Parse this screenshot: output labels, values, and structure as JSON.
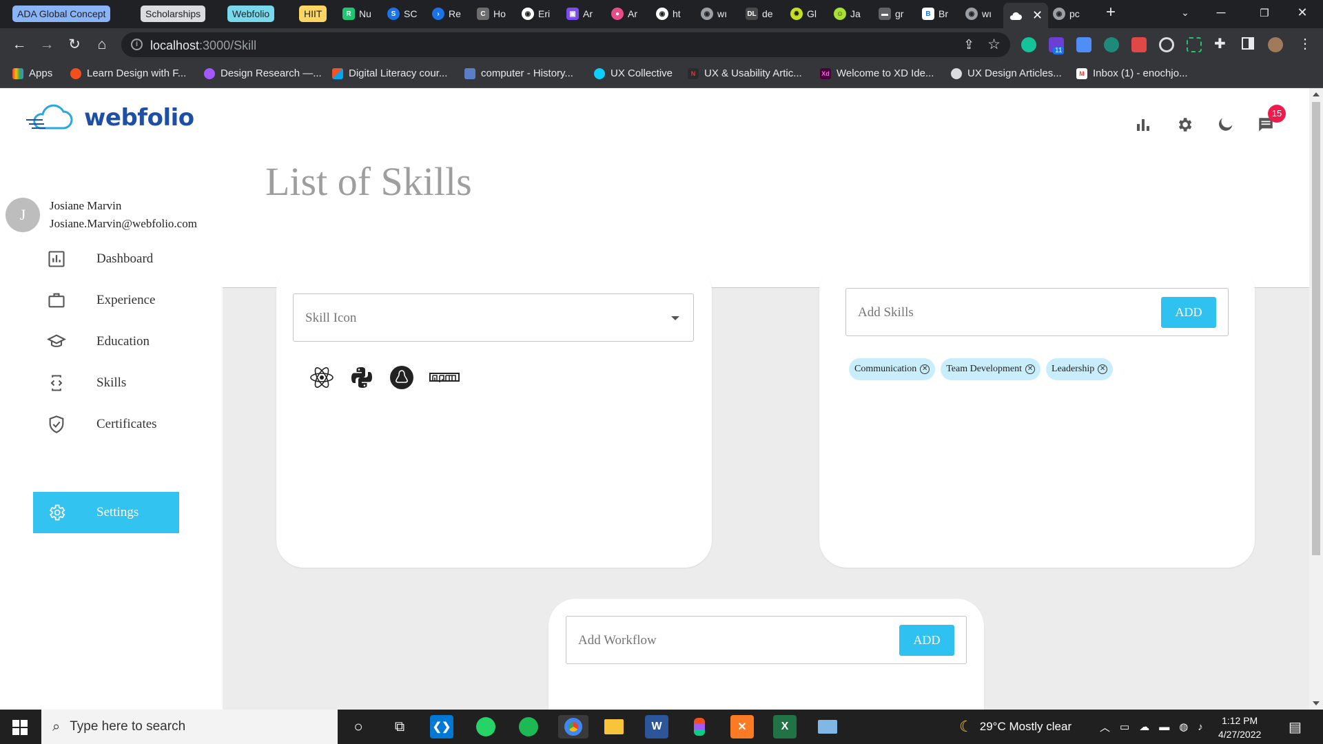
{
  "browser": {
    "tab_groups": [
      "ADA Global Concept",
      "Scholarships",
      "Webfolio",
      "HIIT"
    ],
    "mini_tabs": [
      "Nu",
      "SC",
      "Re",
      "Ho",
      "Eri",
      "Ar",
      "Ar",
      "ht",
      "wı",
      "de",
      "Gl",
      "Ja",
      "gr",
      "Br",
      "wı",
      "pc"
    ],
    "url_host": "localhost",
    "url_path": ":3000/Skill",
    "bookmarks": [
      "Apps",
      "Learn Design with F...",
      "Design Research —...",
      "Digital Literacy cour...",
      "computer - History...",
      "UX Collective",
      "UX & Usability Artic...",
      "Welcome to XD Ide...",
      "UX Design Articles...",
      "Inbox (1) - enochjo..."
    ],
    "extension_badge": "11"
  },
  "app": {
    "logo_text": "webfolio",
    "notification_count": "15",
    "page_title": "List of Skills",
    "user": {
      "initial": "J",
      "name": "Josiane Marvin",
      "email": "Josiane.Marvin@webfolio.com"
    },
    "nav": {
      "dashboard": "Dashboard",
      "experience": "Experience",
      "education": "Education",
      "skills": "Skills",
      "certificates": "Certificates",
      "settings": "Settings"
    },
    "skill_icon_select": {
      "placeholder": "Skill Icon",
      "icons": [
        "react-icon",
        "python-icon",
        "linux-icon",
        "npm-icon"
      ]
    },
    "add_skills": {
      "placeholder": "Add Skills",
      "button": "ADD",
      "chips": [
        "Communication",
        "Team Development",
        "Leadership"
      ]
    },
    "add_workflow": {
      "placeholder": "Add Workflow",
      "button": "ADD"
    },
    "accent_color": "#32c3f0"
  },
  "taskbar": {
    "search_placeholder": "Type here to search",
    "weather": "29°C  Mostly clear",
    "time": "1:12 PM",
    "date": "4/27/2022"
  }
}
